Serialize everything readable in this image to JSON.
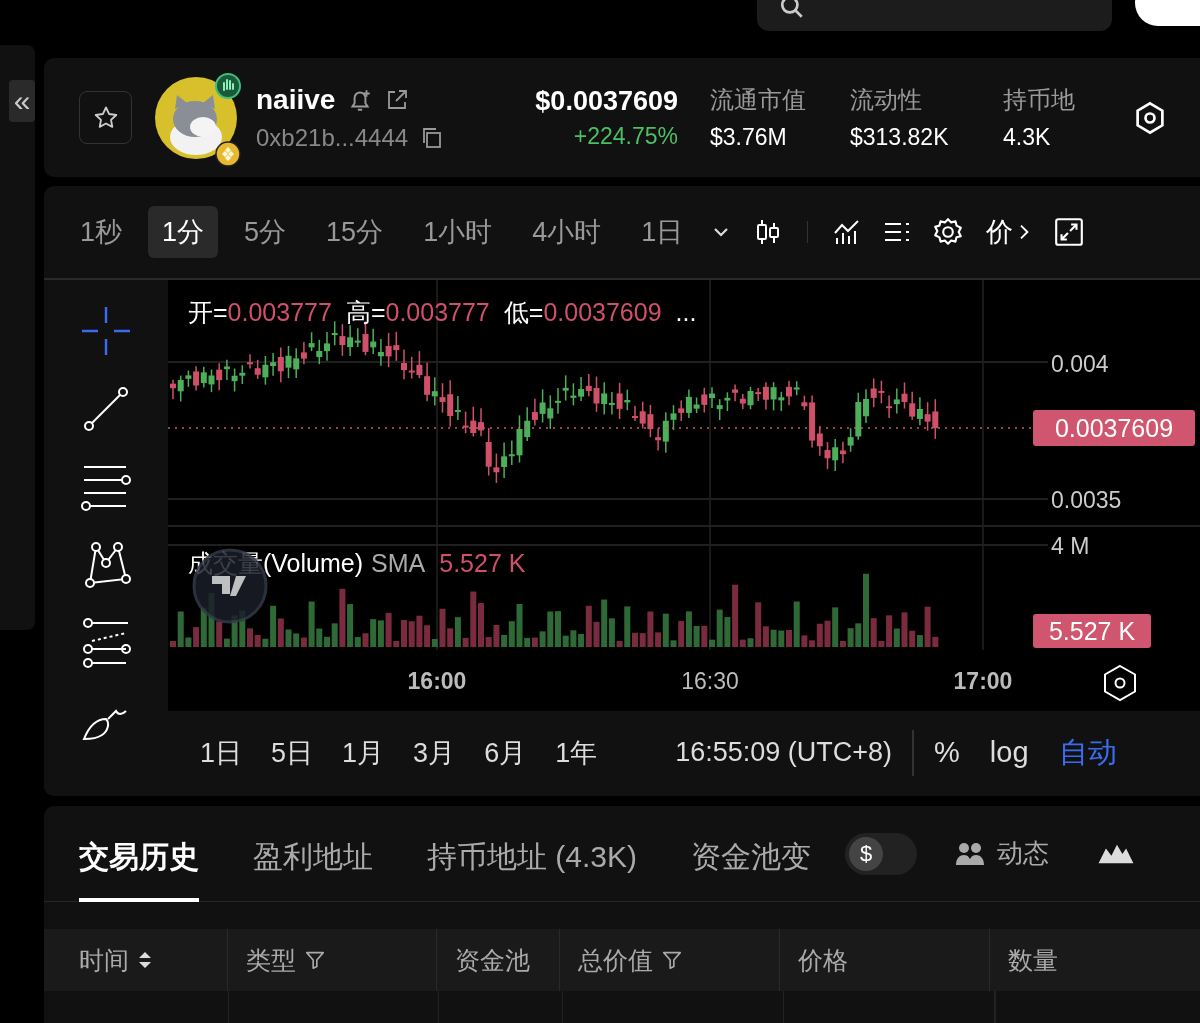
{
  "sidebar_toggle": "«",
  "token": {
    "name": "naiive",
    "address": "0xb21b...4444",
    "price": "$0.0037609",
    "change": "+224.75%",
    "favorite": false
  },
  "stats": [
    {
      "label": "流通市值",
      "value": "$3.76M"
    },
    {
      "label": "流动性",
      "value": "$313.82K"
    },
    {
      "label": "持币地",
      "value": "4.3K"
    }
  ],
  "intervals": [
    {
      "label": "1秒",
      "selected": false
    },
    {
      "label": "1分",
      "selected": true
    },
    {
      "label": "5分",
      "selected": false
    },
    {
      "label": "15分",
      "selected": false
    },
    {
      "label": "1小时",
      "selected": false
    },
    {
      "label": "4小时",
      "selected": false
    },
    {
      "label": "1日",
      "selected": false
    }
  ],
  "price_button": "价",
  "legend": [
    {
      "label": "开=",
      "value": "0.003777"
    },
    {
      "label": "高=",
      "value": "0.003777"
    },
    {
      "label": "低=",
      "value": "0.0037609"
    }
  ],
  "legend_more": "...",
  "y_ticks": [
    "0.004",
    "0.0035"
  ],
  "last_price": "0.0037609",
  "volume": {
    "title": "成交量(Volume)",
    "ma": "SMA",
    "value": "5.527 K",
    "tick": "4 M",
    "last": "5.527 K"
  },
  "x_ticks": [
    {
      "label": "16:00",
      "major": true
    },
    {
      "label": "16:30",
      "major": false
    },
    {
      "label": "17:00",
      "major": true
    }
  ],
  "ranges": [
    "1日",
    "5日",
    "1月",
    "3月",
    "6月",
    "1年"
  ],
  "clock": "16:55:09 (UTC+8)",
  "scale_options": [
    {
      "label": "%",
      "selected": false
    },
    {
      "label": "log",
      "selected": false
    },
    {
      "label": "自动",
      "selected": true
    }
  ],
  "tabs": [
    {
      "label": "交易历史",
      "selected": true
    },
    {
      "label": "盈利地址",
      "selected": false
    },
    {
      "label": "持币地址 (4.3K)",
      "selected": false
    },
    {
      "label": "资金池变",
      "selected": false
    }
  ],
  "usd_toggle": {
    "symbol": "$",
    "on": false
  },
  "activity": "动态",
  "columns": [
    {
      "label": "时间",
      "kind": "sort"
    },
    {
      "label": "类型",
      "kind": "filter"
    },
    {
      "label": "资金池",
      "kind": "plain"
    },
    {
      "label": "总价值",
      "kind": "filter"
    },
    {
      "label": "价格",
      "kind": "plain"
    },
    {
      "label": "数量",
      "kind": "plain"
    }
  ]
}
